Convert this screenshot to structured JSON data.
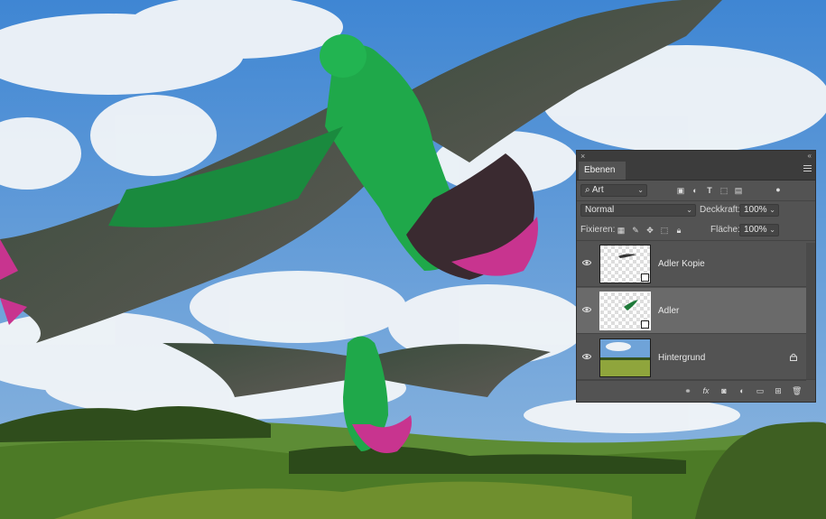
{
  "panel": {
    "tab_label": "Ebenen",
    "close_glyph": "×",
    "collapse_glyph": "«",
    "filter": {
      "kind_value": "Art",
      "icons": [
        "image-filter-icon",
        "adjustment-filter-icon",
        "type-filter-icon",
        "shape-filter-icon",
        "smart-object-filter-icon"
      ]
    },
    "blend_mode": "Normal",
    "opacity": {
      "label": "Deckkraft:",
      "value": "100%"
    },
    "lock": {
      "label": "Fixieren:"
    },
    "fill": {
      "label": "Fläche:",
      "value": "100%"
    },
    "layers": [
      {
        "name": "Adler Kopie",
        "visible": true,
        "selected": false,
        "locked": false
      },
      {
        "name": "Adler",
        "visible": true,
        "selected": true,
        "locked": false
      },
      {
        "name": "Hintergrund",
        "visible": true,
        "selected": false,
        "locked": true
      }
    ],
    "footer_icons": [
      "link-layers-icon",
      "fx-icon",
      "add-mask-icon",
      "new-adjustment-layer-icon",
      "new-group-icon",
      "new-layer-icon",
      "delete-layer-icon"
    ],
    "fx_glyph": "fx"
  },
  "colors": {
    "panel_bg": "#535353",
    "selected_layer": "#6a6a6a",
    "sky": "#4f8fd1",
    "grass": "#4f7d2a",
    "eagle_body": "#1fa84a",
    "feather_tips": "#c8348f"
  }
}
